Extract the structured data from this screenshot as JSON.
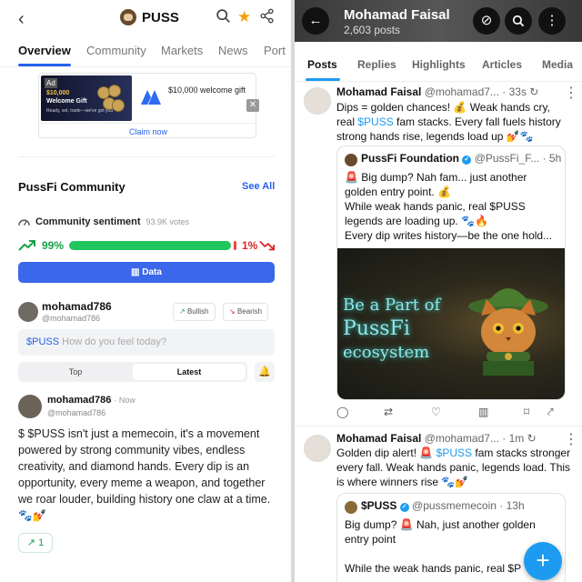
{
  "left": {
    "header": {
      "back_icon": "chevron-left",
      "title": "PUSS",
      "icons": [
        "search-icon",
        "star-icon",
        "share-icon"
      ]
    },
    "tabs": [
      "Overview",
      "Community",
      "Markets",
      "News",
      "Port"
    ],
    "ad": {
      "badge": "Ad",
      "img_line1": "$10,000",
      "img_line2": "Welcome Gift",
      "img_line3": "Ready, set, trade—we've got you",
      "text": "$10,000 welcome gift",
      "claim": "Claim now",
      "close": "✕"
    },
    "community": {
      "title": "PussFi Community",
      "see_all": "See All",
      "sentiment_title": "Community sentiment",
      "votes": "93.9K votes",
      "bullish_pct": "99%",
      "bearish_pct": "1%",
      "bullish_fraction": 0.99,
      "data_button": "Data"
    },
    "composer": {
      "name": "mohamad786",
      "handle": "@mohamad786",
      "bullish": "Bullish",
      "bearish": "Bearish",
      "ticker": "$PUSS",
      "placeholder": "How do you feel today?"
    },
    "sort": {
      "top": "Top",
      "latest": "Latest"
    },
    "post": {
      "name": "mohamad786",
      "time": "· Now",
      "handle": "@mohamad786",
      "body": "$ $PUSS isn't just a memecoin, it's a movement powered by strong community vibes, endless creativity, and diamond hands. Every dip is an opportunity, every meme a weapon, and together we roar louder, building history one claw at a time. 🐾💅",
      "reaction_count": "1"
    }
  },
  "right": {
    "header": {
      "name": "Mohamad Faisal",
      "posts": "2,603 posts"
    },
    "tabs": [
      "Posts",
      "Replies",
      "Highlights",
      "Articles",
      "Media"
    ],
    "tweet1": {
      "name": "Mohamad Faisal",
      "handle": "@mohamad7...",
      "time": "· 33s",
      "body_pre": "Dips = golden chances! 💰 Weak hands cry, real ",
      "tag": "$PUSS",
      "body_post": " fam stacks. Every fall fuels history strong hands rise, legends load up 💅🐾",
      "quote": {
        "name": "PussFi Foundation",
        "handle": "@PussFi_F...",
        "time": "· 5h",
        "body": "🚨 Big dump? Nah fam... just another golden entry point. 💰\nWhile weak hands panic, real $PUSS legends are loading up. 🐾🔥\nEvery dip writes history—be the one hold...",
        "image_line1": "Be a Part of",
        "image_line2": "PussFi",
        "image_line3": "ecosystem"
      }
    },
    "tweet2": {
      "name": "Mohamad Faisal",
      "handle": "@mohamad7...",
      "time": "· 1m",
      "body_pre": "Golden dip alert! 🚨 ",
      "tag": "$PUSS",
      "body_post": " fam stacks stronger every fall. Weak hands panic, legends load. This is where winners rise 🐾💅",
      "quote": {
        "name": "$PUSS",
        "handle": "@pussmemecoin",
        "time": "· 13h",
        "body": "Big dump? 🚨 Nah, just another golden entry point\n\nWhile the weak hands panic,  real $P"
      }
    },
    "fab": "+"
  }
}
